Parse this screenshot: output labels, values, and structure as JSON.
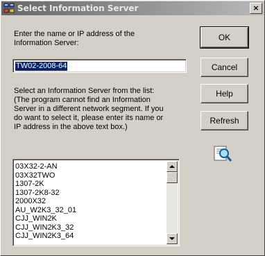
{
  "window": {
    "title": "Select Information Server",
    "close_label": "×",
    "title_icon": "server-network-icon"
  },
  "form": {
    "enter_label": "Enter the name or IP address of the\nInformation Server:",
    "server_value": "TW02-2008-64",
    "select_label": "Select an Information Server from the list:\n(The program cannot find an Information\nServer in a different network segment. If you\ndo want to select it, please enter its name or\nIP address in the above text box.)"
  },
  "buttons": {
    "ok": "OK",
    "cancel": "Cancel",
    "help": "Help",
    "refresh": "Refresh"
  },
  "search_icon": "magnifier-document-icon",
  "server_list": [
    "03X32-2-AN",
    "03X32TWO",
    "1307-2K",
    "1307-2K8-32",
    "2000X32",
    "AU_W2K3_32_01",
    "CJJ_WIN2K",
    "CJJ_WIN2K3_32",
    "CJJ_WIN2K3_64"
  ]
}
